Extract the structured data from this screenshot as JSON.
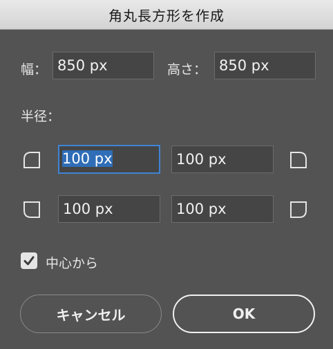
{
  "dialog": {
    "title": "角丸長方形を作成"
  },
  "size": {
    "width_label": "幅：",
    "width_value": "850 px",
    "height_label": "高さ：",
    "height_value": "850 px"
  },
  "radius": {
    "label": "半径：",
    "top_left": "100 px",
    "top_right": "100 px",
    "bottom_left": "100 px",
    "bottom_right": "100 px"
  },
  "options": {
    "from_center_label": "中心から",
    "from_center_checked": true
  },
  "buttons": {
    "cancel": "キャンセル",
    "ok": "OK"
  },
  "colors": {
    "background": "#535353",
    "field_background": "#454545",
    "focus_accent": "#3f84d6",
    "selection": "#2f6db7"
  }
}
